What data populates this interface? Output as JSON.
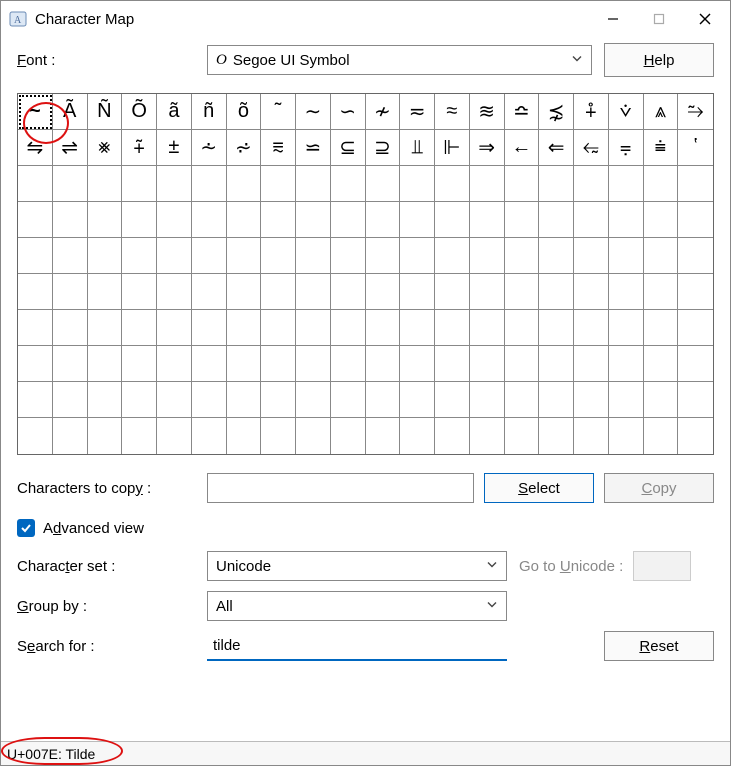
{
  "window": {
    "title": "Character Map"
  },
  "labels": {
    "font": "Font :",
    "help": "Help",
    "chars_to_copy": "Characters to copy :",
    "select": "Select",
    "copy": "Copy",
    "advanced_view": "Advanced view",
    "char_set": "Character set :",
    "go_to_unicode": "Go to Unicode :",
    "group_by": "Group by :",
    "search_for": "Search for :",
    "reset": "Reset"
  },
  "font_select": {
    "value": "Segoe UI Symbol"
  },
  "grid": {
    "cols": 20,
    "rows": 10,
    "chars": [
      "~",
      "Ã",
      "Ñ",
      "Õ",
      "ã",
      "ñ",
      "õ",
      "˜",
      "∼",
      "∽",
      "≁",
      "≂",
      "≈",
      "≋",
      "≏",
      "⋨",
      "⨢",
      "⩒",
      "⩓",
      "⥲",
      "⇋",
      "⇌",
      "⨳",
      "⨤",
      "±",
      "⩪",
      "⩫",
      "⩳",
      "⋍",
      "⊆",
      "⊇",
      "⫫",
      "⊩",
      "⇒",
      "←",
      "⇐",
      "⥳",
      "⩦",
      "⩧",
      "ʽ"
    ],
    "selected_index": 0
  },
  "copy_field": {
    "value": ""
  },
  "advanced_checked": true,
  "char_set": {
    "value": "Unicode"
  },
  "group_by": {
    "value": "All"
  },
  "search": {
    "value": "tilde"
  },
  "status": "U+007E: Tilde"
}
